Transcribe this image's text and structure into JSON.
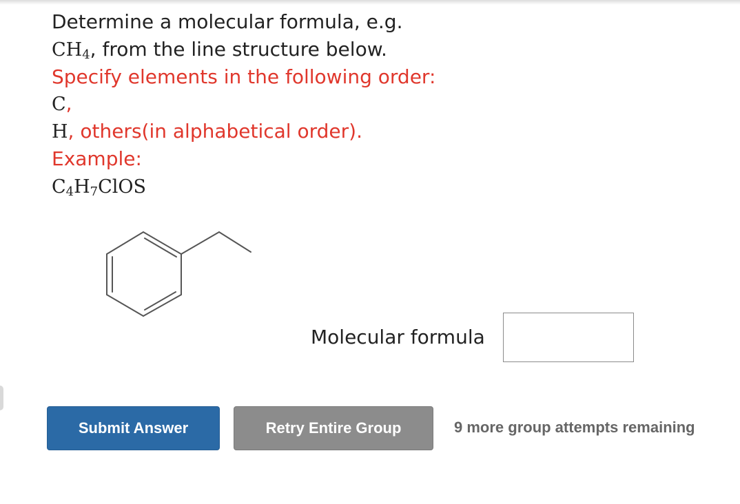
{
  "question": {
    "line1": "Determine a molecular formula, e.g.",
    "line2_formula_base_1": "CH",
    "line2_formula_sub_1": "4",
    "line2_text": ", from the line structure below.",
    "line3": "Specify elements in the following order:",
    "line4_formula": "C",
    "line4_comma": ",",
    "line5_formula": "H",
    "line5_text": ", others(in alphabetical order).",
    "line6": "Example:",
    "example": {
      "c": "C",
      "c_sub": "4",
      "h": "H",
      "h_sub": "7",
      "rest": "ClOS"
    }
  },
  "answer": {
    "label": "Molecular formula",
    "value": ""
  },
  "buttons": {
    "submit": "Submit Answer",
    "retry": "Retry Entire Group"
  },
  "attempts_text": "9 more group attempts remaining",
  "colors": {
    "text": "#222222",
    "instruction_red": "#e0372c",
    "submit_blue": "#2b6aa6",
    "retry_gray": "#8c8c8c",
    "attempts_gray": "#666666",
    "bond_gray": "#555555"
  }
}
